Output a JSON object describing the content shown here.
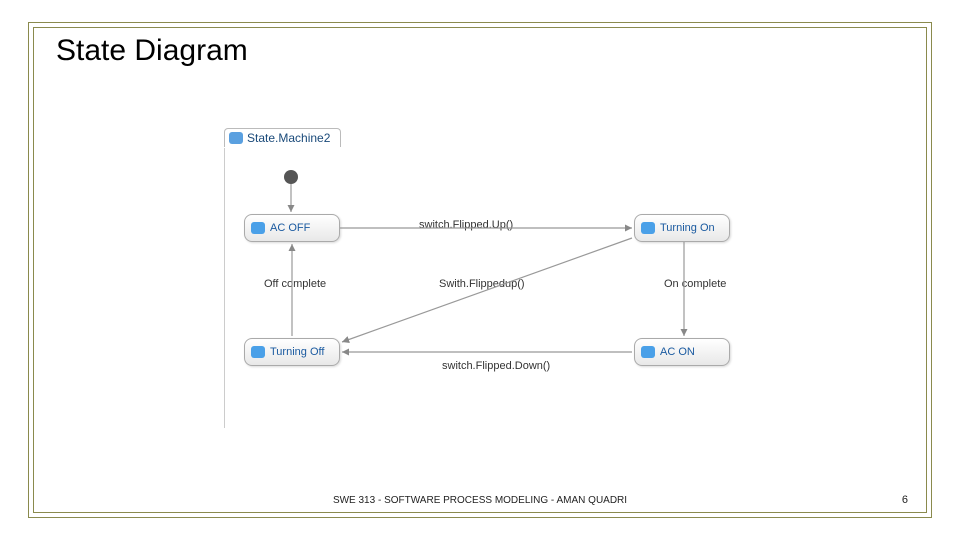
{
  "slide": {
    "title": "State Diagram",
    "footer": "SWE 313 - SOFTWARE PROCESS MODELING - AMAN QUADRI",
    "page_number": "6"
  },
  "diagram": {
    "tab_label": "State.Machine2",
    "states": {
      "ac_off": "AC OFF",
      "turning_on": "Turning On",
      "turning_off": "Turning Off",
      "ac_on": "AC ON"
    },
    "transitions": {
      "t1": "switch.Flipped.Up()",
      "t2": "On complete",
      "t3": "switch.Flipped.Down()",
      "t4": "Off complete",
      "t5": "Swith.Flippedup()"
    }
  }
}
